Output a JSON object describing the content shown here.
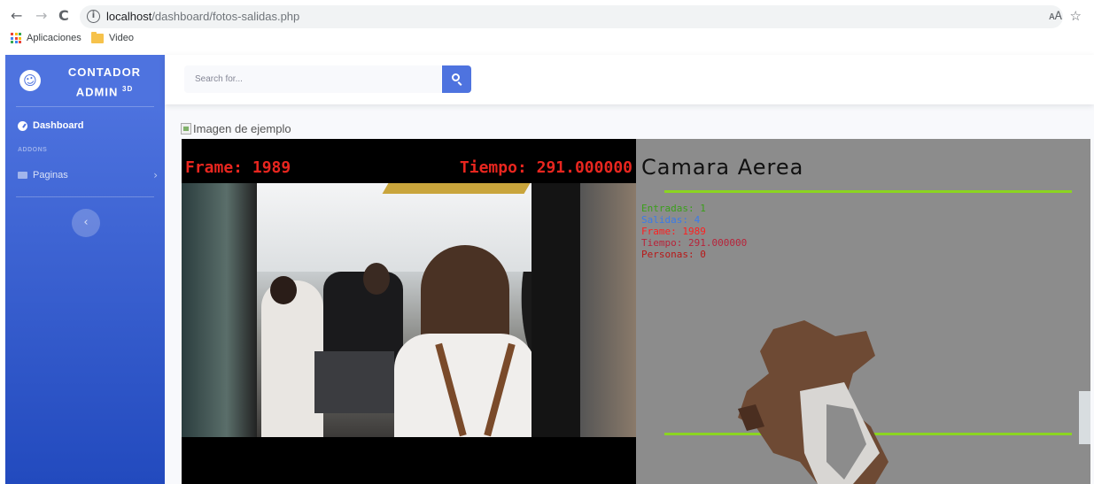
{
  "browser": {
    "nav": {
      "back": "←",
      "forward": "→",
      "reload": "C"
    },
    "url_host": "localhost",
    "url_path": "/dashboard/fotos-salidas.php",
    "bookmarks": [
      {
        "label": "Aplicaciones",
        "icon": "apps-grid-icon"
      },
      {
        "label": "Video",
        "icon": "folder-icon"
      }
    ]
  },
  "sidebar": {
    "brand_title": "CONTADOR",
    "brand_subtitle": "ADMIN",
    "brand_sup": "3D",
    "items": [
      {
        "label": "Dashboard",
        "icon": "tachometer-icon"
      },
      {
        "label": "Paginas",
        "icon": "folder-icon"
      }
    ],
    "heading": "ADDONS",
    "toggle_icon": "‹"
  },
  "topbar": {
    "search_placeholder": "Search for...",
    "search_icon": "search-icon"
  },
  "content": {
    "image_alt": "Imagen de ejemplo",
    "camera_left": {
      "frame_text": "Frame: 1989",
      "time_text": "Tiempo: 291.000000"
    },
    "camera_right": {
      "title": "Camara Aerea",
      "stats": [
        {
          "text": "Entradas: 1",
          "color": "#3aa01a"
        },
        {
          "text": "Salidas: 4",
          "color": "#3b7be8"
        },
        {
          "text": "Frame: 1989",
          "color": "#ff1f1f"
        },
        {
          "text": "Tiempo: 291.000000",
          "color": "#b8233a"
        },
        {
          "text": "Personas: 0",
          "color": "#b81818"
        }
      ],
      "line_color": "#8bd421"
    }
  },
  "colors": {
    "primary": "#4e73df",
    "sidebar_gradient_end": "#224abe",
    "overlay_red": "#e8261f"
  }
}
